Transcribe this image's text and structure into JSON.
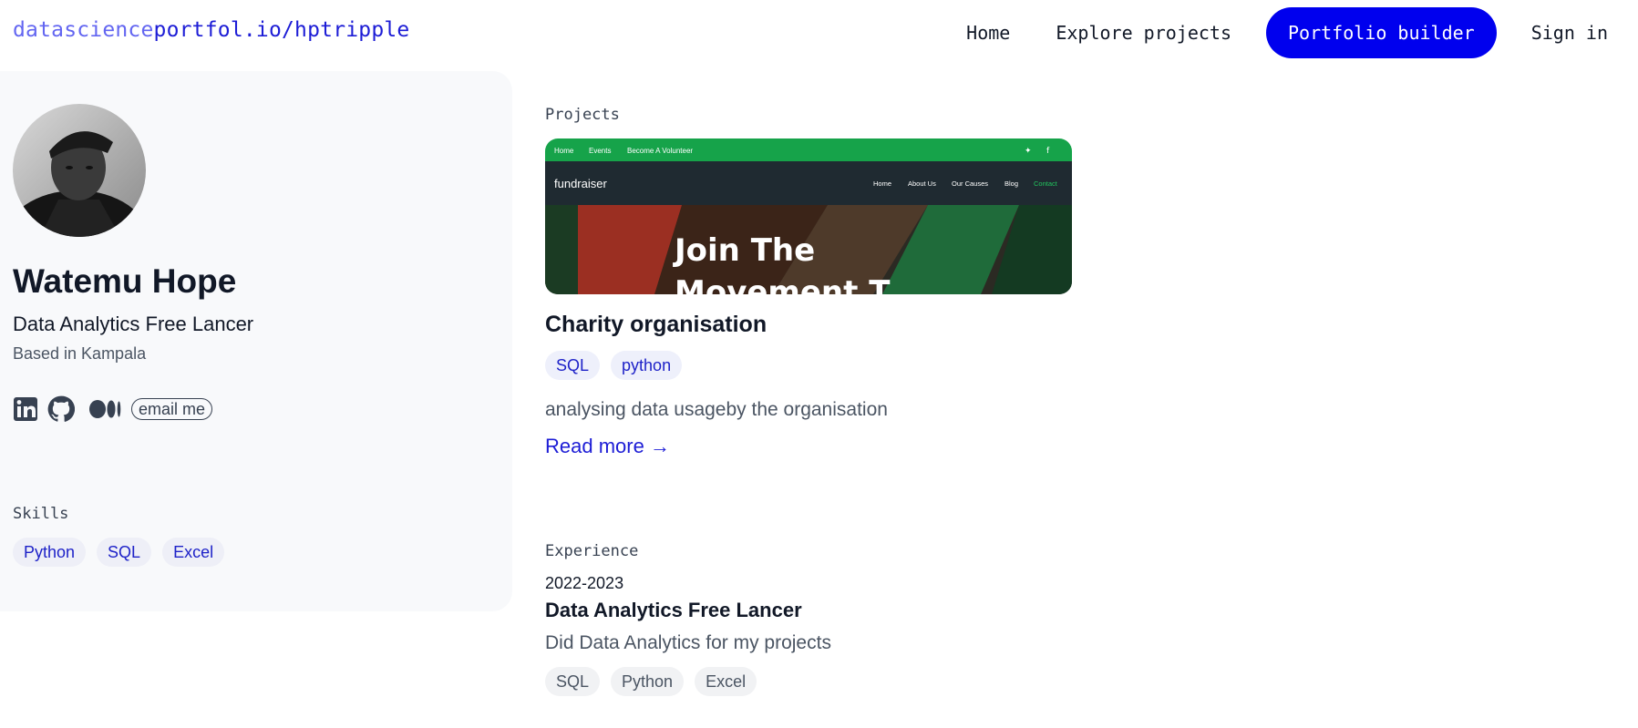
{
  "brand": {
    "prefix": "datascience",
    "suffix": "portfol.io/hptripple"
  },
  "nav": {
    "home": "Home",
    "explore": "Explore projects",
    "builder": "Portfolio builder",
    "signin": "Sign in"
  },
  "profile": {
    "name": "Watemu Hope",
    "role": "Data Analytics Free Lancer",
    "location": "Based in Kampala",
    "email_label": "email me",
    "social_icons": [
      "linkedin-icon",
      "github-icon",
      "medium-icon"
    ]
  },
  "skills": {
    "label": "Skills",
    "items": [
      "Python",
      "SQL",
      "Excel"
    ]
  },
  "projects": {
    "label": "Projects",
    "items": [
      {
        "title": "Charity organisation",
        "tags": [
          "SQL",
          "python"
        ],
        "description": "analysing data usageby the organisation",
        "read_more": "Read more →",
        "thumbnail": {
          "topbar_links": [
            "Home",
            "Events",
            "Become A Volunteer"
          ],
          "site_name": "fundraiser",
          "menu": [
            "Home",
            "About Us",
            "Our Causes",
            "Blog",
            "Contact"
          ],
          "hero_text": "Join The",
          "hero_text_cut": "Movement T"
        }
      }
    ]
  },
  "experience": {
    "label": "Experience",
    "items": [
      {
        "years": "2022-2023",
        "title": "Data Analytics Free Lancer",
        "description": "Did Data Analytics for my projects",
        "tags": [
          "SQL",
          "Python",
          "Excel"
        ]
      }
    ]
  },
  "colors": {
    "accent": "#0000ee",
    "brand_prefix": "#6366f1",
    "link": "#1d1dd6",
    "thumb_green": "#16a34a",
    "thumb_dark": "#1f2a31"
  }
}
